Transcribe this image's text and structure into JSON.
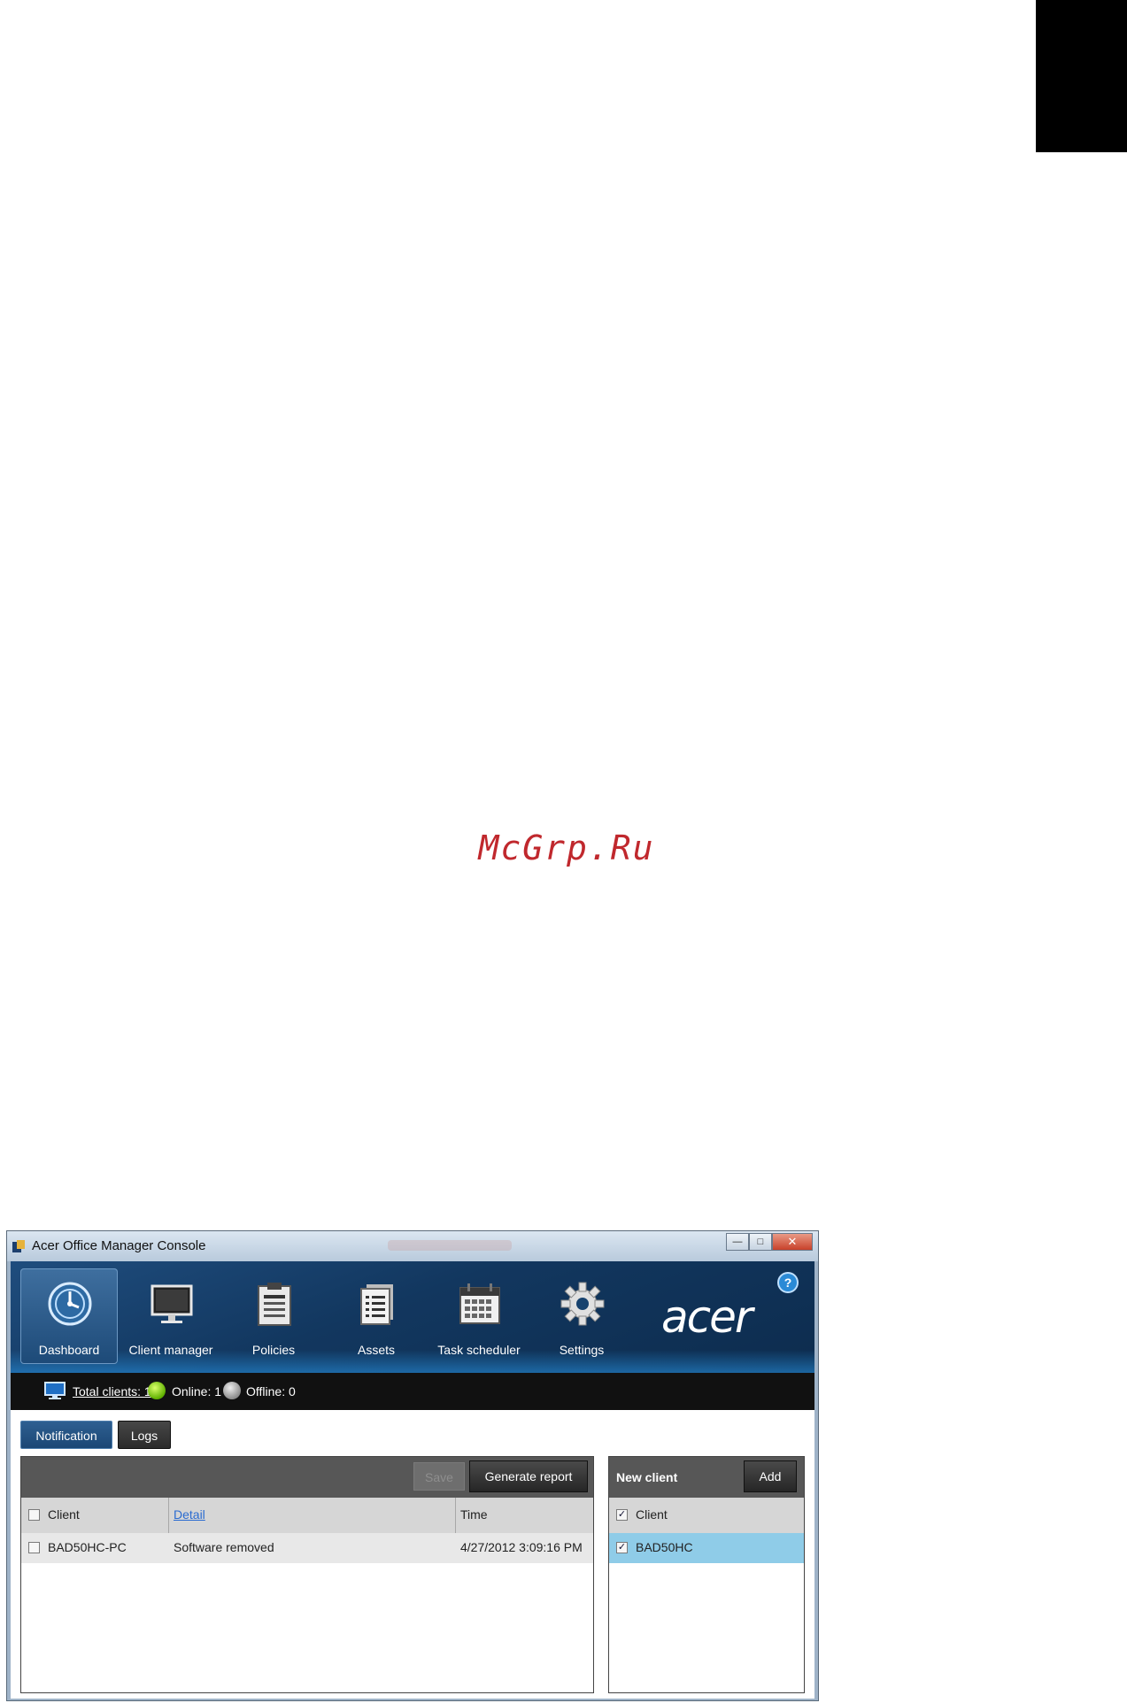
{
  "window": {
    "title": "Acer Office Manager Console"
  },
  "nav": [
    {
      "label": "Dashboard",
      "icon": "dashboard-icon"
    },
    {
      "label": "Client manager",
      "icon": "monitor-icon"
    },
    {
      "label": "Policies",
      "icon": "clipboard-icon"
    },
    {
      "label": "Assets",
      "icon": "documents-icon"
    },
    {
      "label": "Task scheduler",
      "icon": "calendar-icon"
    },
    {
      "label": "Settings",
      "icon": "gear-icon"
    }
  ],
  "brand": {
    "logo_text": "acer",
    "help": "?"
  },
  "status": {
    "total": "Total clients: 1",
    "online": "Online: 1",
    "offline": "Offline: 0"
  },
  "tabs": {
    "notification": "Notification",
    "logs": "Logs"
  },
  "notifications": {
    "save_label": "Save",
    "report_label": "Generate report",
    "columns": {
      "client": "Client",
      "detail": "Detail",
      "time": "Time"
    },
    "rows": [
      {
        "client": "BAD50HC-PC",
        "detail": "Software removed",
        "time": "4/27/2012 3:09:16 PM"
      }
    ]
  },
  "new_client": {
    "title": "New client",
    "add_label": "Add",
    "column": "Client",
    "rows": [
      {
        "name": "BAD50HC",
        "checked": true
      }
    ]
  },
  "watermark": "McGrp.Ru",
  "colors": {
    "ribbon": "#12375f",
    "selected_row": "#8fcce8",
    "accent_tab": "#1b4775"
  }
}
